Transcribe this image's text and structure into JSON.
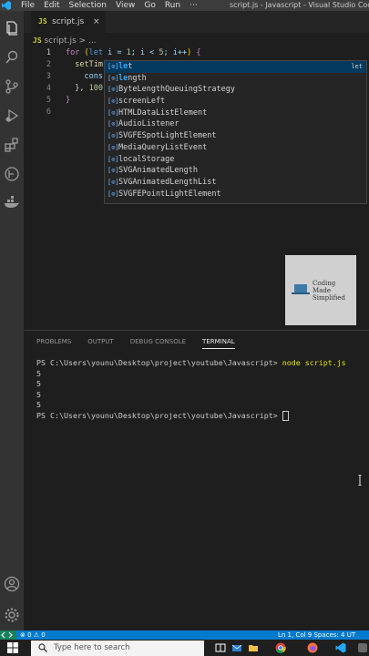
{
  "menu": [
    "File",
    "Edit",
    "Selection",
    "View",
    "Go",
    "Run",
    "···"
  ],
  "window_title": "script.js - Javascript - Visual Studio Code",
  "tab": {
    "icon": "JS",
    "label": "script.js",
    "close": "×"
  },
  "breadcrumb": {
    "file": "script.js",
    "sep": ">",
    "rest": "..."
  },
  "editor": {
    "line_numbers": [
      "1",
      "2",
      "3",
      "4",
      "5",
      "6"
    ],
    "line1": {
      "kw": "for",
      "open": " (",
      "let": "let",
      "mid": " i = ",
      "n1": "1",
      "s1": "; i < ",
      "n2": "5",
      "s2": "; i++",
      "close": ")",
      "brace": " {"
    },
    "line2": "  setTim",
    "line3": "    cons",
    "line4_a": "  }, ",
    "line4_num": "100",
    "line5": "}"
  },
  "suggest": {
    "items": [
      {
        "icon": "[⊙]",
        "pre": "",
        "hl": "le",
        "post": "t",
        "detail": "let"
      },
      {
        "icon": "[⊙]",
        "pre": "",
        "hl": "le",
        "post": "ngth"
      },
      {
        "icon": "[⊙]",
        "pre": "ByteLengthQueuingStrategy",
        "hl": "",
        "post": ""
      },
      {
        "icon": "[⊙]",
        "pre": "screenLeft",
        "hl": "",
        "post": ""
      },
      {
        "icon": "[⊙]",
        "pre": "HTMLDataListElement",
        "hl": "",
        "post": ""
      },
      {
        "icon": "[⊙]",
        "pre": "AudioListener",
        "hl": "",
        "post": ""
      },
      {
        "icon": "[⊙]",
        "pre": "SVGFESpotLightElement",
        "hl": "",
        "post": ""
      },
      {
        "icon": "[⊙]",
        "pre": "MediaQueryListEvent",
        "hl": "",
        "post": ""
      },
      {
        "icon": "[⊙]",
        "pre": "localStorage",
        "hl": "",
        "post": ""
      },
      {
        "icon": "[⊙]",
        "pre": "SVGAnimatedLength",
        "hl": "",
        "post": ""
      },
      {
        "icon": "[⊙]",
        "pre": "SVGAnimatedLengthList",
        "hl": "",
        "post": ""
      },
      {
        "icon": "[⊙]",
        "pre": "SVGFEPointLightElement",
        "hl": "",
        "post": ""
      }
    ]
  },
  "watermark": {
    "line1": "Coding",
    "line2": "Made",
    "line3": "Simplified"
  },
  "panel": {
    "tabs": [
      "PROBLEMS",
      "OUTPUT",
      "DEBUG CONSOLE",
      "TERMINAL"
    ],
    "prompt1": "PS C:\\Users\\younu\\Desktop\\project\\youtube\\Javascript> ",
    "cmd": "node script.js",
    "outputs": [
      "5",
      "5",
      "5",
      "5"
    ],
    "prompt2": "PS C:\\Users\\younu\\Desktop\\project\\youtube\\Javascript> "
  },
  "status": {
    "errors": "⊗ 0 ⚠ 0",
    "right": "Ln 1, Col 9   Spaces: 4   UT"
  },
  "taskbar": {
    "search_placeholder": "Type here to search"
  },
  "colors": {
    "accent": "#007acc",
    "activity": "#333333",
    "editor_bg": "#1e1e1e"
  }
}
